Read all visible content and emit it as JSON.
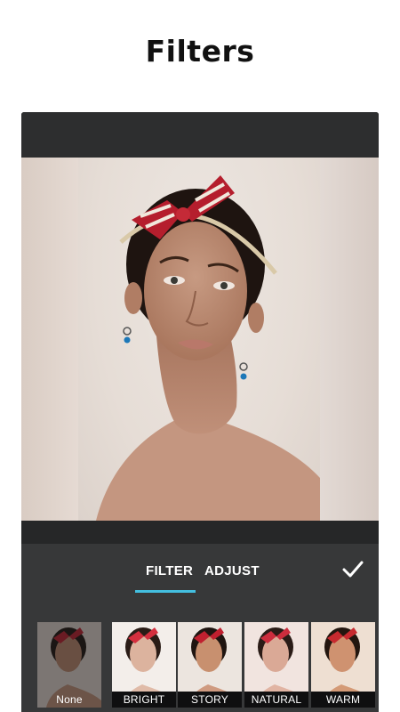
{
  "headline": "Filters",
  "tabs": [
    {
      "label": "FILTER",
      "active": true
    },
    {
      "label": "ADJUST",
      "active": false
    }
  ],
  "confirm_icon": "checkmark-icon",
  "accent_color": "#43bfe0",
  "filters": [
    {
      "label": "None",
      "selected": true
    },
    {
      "label": "BRIGHT",
      "selected": false
    },
    {
      "label": "STORY",
      "selected": false
    },
    {
      "label": "NATURAL",
      "selected": false
    },
    {
      "label": "WARM",
      "selected": false
    }
  ]
}
